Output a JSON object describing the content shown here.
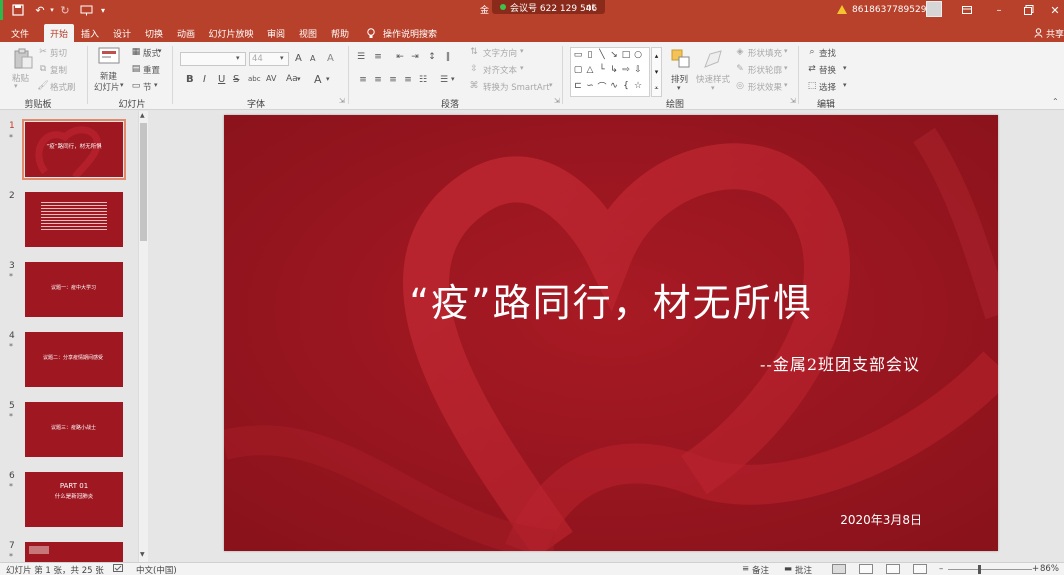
{
  "titlebar": {
    "doc_title_visible": "金",
    "doc_title_tail": "nt",
    "meeting_label": "会议号 622 129 546",
    "account": "8618637789529",
    "qat_icons": [
      "save-icon",
      "undo-icon",
      "redo-icon",
      "slideshow-icon",
      "customize-icon"
    ],
    "window_icons": [
      "ribbon-display-icon",
      "minimize-icon",
      "restore-icon",
      "close-icon"
    ]
  },
  "tabs": [
    "文件",
    "开始",
    "插入",
    "设计",
    "切换",
    "动画",
    "幻灯片放映",
    "审阅",
    "视图",
    "帮助"
  ],
  "active_tab": "开始",
  "tell_me": "操作说明搜索",
  "share": "共享",
  "ribbon": {
    "clipboard": {
      "label": "剪贴板",
      "paste": "粘贴",
      "cut": "剪切",
      "copy": "复制",
      "painter": "格式刷"
    },
    "slides": {
      "label": "幻灯片",
      "new_slide_1": "新建",
      "new_slide_2": "幻灯片",
      "layout": "版式",
      "reset": "重置",
      "section": "节"
    },
    "font": {
      "label": "字体",
      "font_size": "44",
      "bold": "B",
      "italic": "I",
      "underline": "U",
      "strike": "S",
      "shadow": "abc",
      "spacing": "AV",
      "case": "Aa",
      "color": "A",
      "grow": "A",
      "shrink": "A",
      "clear": "A"
    },
    "paragraph": {
      "label": "段落",
      "text_direction": "文字方向",
      "align_text": "对齐文本",
      "smartart": "转换为 SmartArt"
    },
    "drawing": {
      "label": "绘图",
      "arrange": "排列",
      "quick_styles": "快速样式",
      "fill": "形状填充",
      "outline": "形状轮廓",
      "effects": "形状效果"
    },
    "editing": {
      "label": "编辑",
      "find": "查找",
      "replace": "替换",
      "select": "选择"
    }
  },
  "thumbnails": [
    {
      "num": "1",
      "star": "*",
      "text": "“疫”路同行，材无所惧"
    },
    {
      "num": "2",
      "star": "",
      "text": ""
    },
    {
      "num": "3",
      "star": "*",
      "text": "议题一：疫中大学习"
    },
    {
      "num": "4",
      "star": "*",
      "text": "议题二：分享疫情期间感受"
    },
    {
      "num": "5",
      "star": "*",
      "text": "议题三：疫路小战士"
    },
    {
      "num": "6",
      "star": "*",
      "text": "PART 01"
    },
    {
      "num": "7",
      "star": "*",
      "text": ""
    }
  ],
  "thumb6_sub": "什么是新冠肺炎",
  "slide": {
    "title": "“疫”路同行，材无所惧",
    "subtitle": "--金属2班团支部会议",
    "date": "2020年3月8日"
  },
  "status": {
    "slide_info": "幻灯片 第 1 张，共 25 张",
    "language": "中文(中国)",
    "notes": "备注",
    "comments": "批注",
    "zoom": "86%",
    "zoom_level": 0.86
  },
  "colors": {
    "accent": "#b8412b",
    "slide_bg": "#9d1620",
    "status_green": "#2db84d"
  }
}
